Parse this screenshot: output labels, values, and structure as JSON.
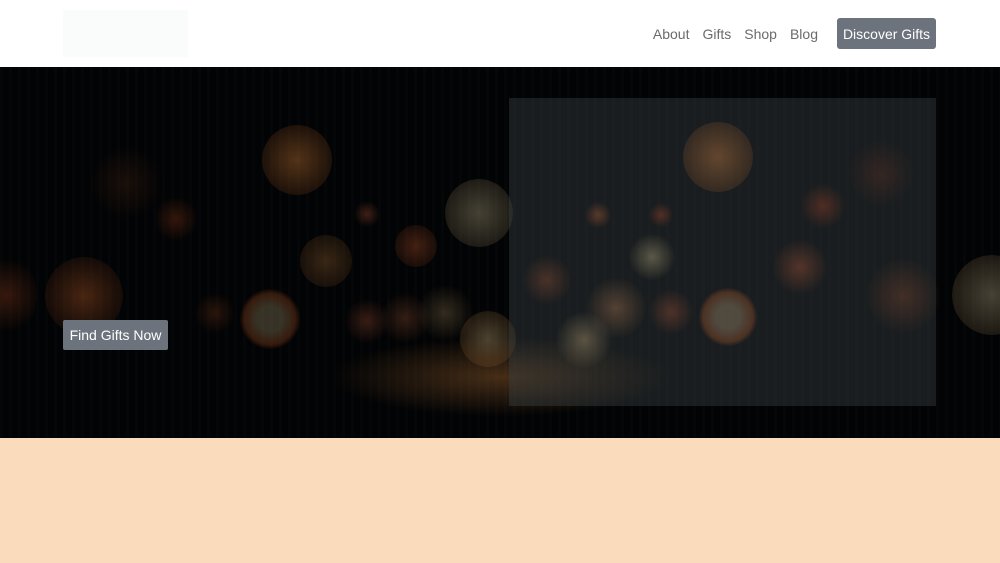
{
  "header": {
    "nav": [
      "About",
      "Gifts",
      "Shop",
      "Blog"
    ],
    "cta_label": "Discover Gifts"
  },
  "hero": {
    "cta_label": "Find Gifts Now"
  },
  "colors": {
    "button_bg": "#6c737c",
    "hero_bg": "#020304",
    "section_bg": "#fadbbb"
  }
}
